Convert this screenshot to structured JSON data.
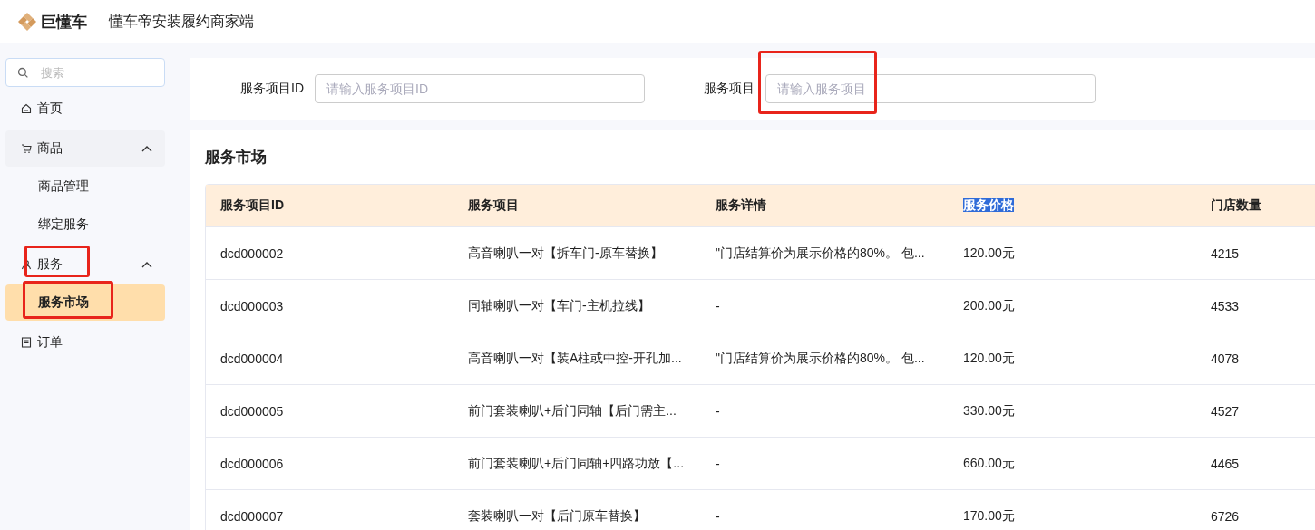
{
  "header": {
    "logo_text": "巨懂车",
    "title": "懂车帝安装履约商家端"
  },
  "sidebar": {
    "search": {
      "placeholder": "搜索"
    },
    "items": [
      {
        "label": "首页",
        "kind": "home",
        "selected": false
      },
      {
        "label": "商品",
        "kind": "cart",
        "expanded": true,
        "selected": false,
        "children": [
          {
            "label": "商品管理",
            "selected": false
          },
          {
            "label": "绑定服务",
            "selected": false
          }
        ]
      },
      {
        "label": "服务",
        "kind": "person",
        "expanded": true,
        "selected": false,
        "children": [
          {
            "label": "服务市场",
            "selected": true
          }
        ]
      },
      {
        "label": "订单",
        "kind": "doc",
        "selected": false
      }
    ]
  },
  "filters": [
    {
      "label": "服务项目ID",
      "placeholder": "请输入服务项目ID"
    },
    {
      "label": "服务项目",
      "placeholder": "请输入服务项目"
    }
  ],
  "section_title": "服务市场",
  "table": {
    "columns": [
      {
        "label": "服务项目ID",
        "highlighted": false
      },
      {
        "label": "服务项目",
        "highlighted": false
      },
      {
        "label": "服务详情",
        "highlighted": false
      },
      {
        "label": "服务价格",
        "highlighted": true
      },
      {
        "label": "门店数量",
        "highlighted": false
      }
    ],
    "rows": [
      [
        "dcd000002",
        "高音喇叭一对【拆车门-原车替换】",
        "\"门店结算价为展示价格的80%。 包...",
        "120.00元",
        "4215"
      ],
      [
        "dcd000003",
        "同轴喇叭一对【车门-主机拉线】",
        "-",
        "200.00元",
        "4533"
      ],
      [
        "dcd000004",
        "高音喇叭一对【装A柱或中控-开孔加...",
        "\"门店结算价为展示价格的80%。 包...",
        "120.00元",
        "4078"
      ],
      [
        "dcd000005",
        "前门套装喇叭+后门同轴【后门需主...",
        "-",
        "330.00元",
        "4527"
      ],
      [
        "dcd000006",
        "前门套装喇叭+后门同轴+四路功放【...",
        "-",
        "660.00元",
        "4465"
      ],
      [
        "dcd000007",
        "套装喇叭一对【后门原车替换】",
        "-",
        "170.00元",
        "6726"
      ]
    ]
  }
}
